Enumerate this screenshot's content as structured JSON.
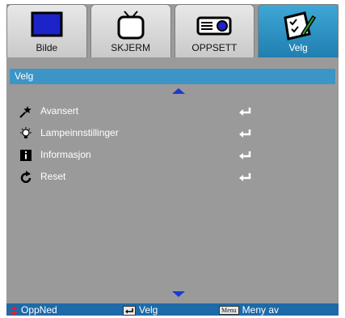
{
  "tabs": [
    {
      "label": "Bilde",
      "icon": "monitor-icon"
    },
    {
      "label": "SKJERM",
      "icon": "tv-icon"
    },
    {
      "label": "OPPSETT",
      "icon": "projector-icon"
    },
    {
      "label": "Velg",
      "icon": "checklist-pen-icon",
      "active": true
    }
  ],
  "menu_title": "Velg",
  "items": [
    {
      "label": "Avansert",
      "icon": "star-pin-icon"
    },
    {
      "label": "Lampeinnstillinger",
      "icon": "lamp-icon"
    },
    {
      "label": "Informasjon",
      "icon": "info-icon"
    },
    {
      "label": "Reset",
      "icon": "reset-icon"
    }
  ],
  "footer": {
    "nav_label": "OppNed",
    "select_label": "Velg",
    "menu_key": "Menu",
    "menu_off_label": "Meny av"
  },
  "colors": {
    "accent": "#3b95c6",
    "footer": "#1e6aa8",
    "arrow": "#1b38d6",
    "panel": "#9a9a9a"
  }
}
